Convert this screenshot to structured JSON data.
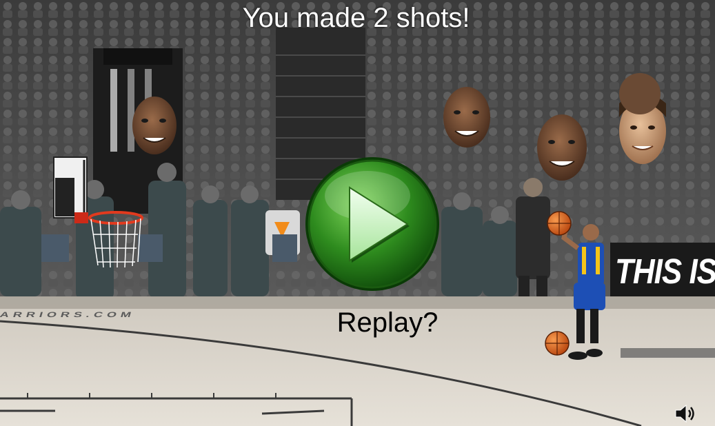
{
  "game": {
    "result_message": "You made 2 shots!",
    "replay_label": "Replay?",
    "banner_text": "THIS IS WI",
    "court_text": "ARRIORS.COM",
    "shots_made": 2
  },
  "icons": {
    "replay": "play-icon",
    "sound": "speaker-icon"
  },
  "colors": {
    "play_button_green": "#2e8b1e",
    "play_arrow": "#d6f5cc",
    "jersey_blue": "#1d4fb5",
    "jersey_gold": "#f5c518",
    "ball_orange": "#e0631c",
    "rim_red": "#e23a1e"
  }
}
